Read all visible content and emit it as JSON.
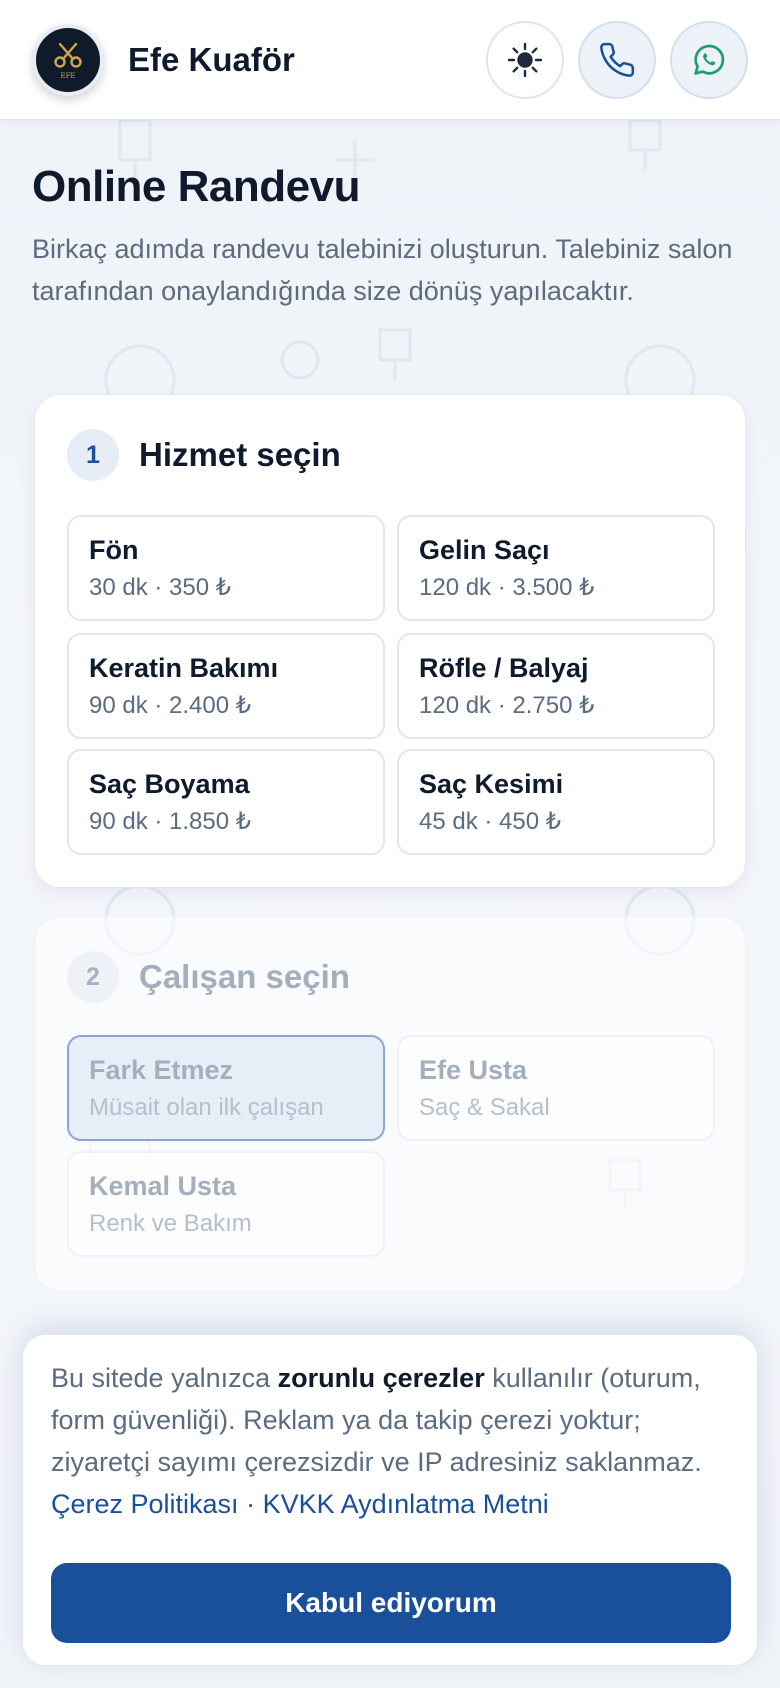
{
  "header": {
    "brand": "Efe Kuaför",
    "logo_text": "EFE",
    "icons": {
      "theme": "sun-icon",
      "phone": "phone-icon",
      "whatsapp": "whatsapp-icon"
    }
  },
  "page": {
    "title": "Online Randevu",
    "description": "Birkaç adımda randevu talebinizi oluşturun. Talebiniz salon tarafından onaylandığında size dönüş yapılacaktır."
  },
  "step1": {
    "number": "1",
    "title": "Hizmet seçin",
    "services": [
      {
        "name": "Fön",
        "meta": "30 dk · 350 ₺"
      },
      {
        "name": "Gelin Saçı",
        "meta": "120 dk · 3.500 ₺"
      },
      {
        "name": "Keratin Bakımı",
        "meta": "90 dk · 2.400 ₺"
      },
      {
        "name": "Röfle / Balyaj",
        "meta": "120 dk · 2.750 ₺"
      },
      {
        "name": "Saç Boyama",
        "meta": "90 dk · 1.850 ₺"
      },
      {
        "name": "Saç Kesimi",
        "meta": "45 dk · 450 ₺"
      }
    ]
  },
  "step2": {
    "number": "2",
    "title": "Çalışan seçin",
    "staff": [
      {
        "name": "Fark Etmez",
        "meta": "Müsait olan ilk çalışan"
      },
      {
        "name": "Efe Usta",
        "meta": "Saç & Sakal"
      },
      {
        "name": "Kemal Usta",
        "meta": "Renk ve Bakım"
      }
    ]
  },
  "cookie": {
    "text_before": "Bu sitede yalnızca ",
    "text_bold": "zorunlu çerezler",
    "text_after": " kullanılır (oturum, form güvenliği). Reklam ya da takip çerezi yoktur; ziyaretçi sayımı çerezsizdir ve IP adresiniz saklanmaz.",
    "policy_link": "Çerez Politikası",
    "separator": " · ",
    "kvkk_link": "KVKK Aydınlatma Metni",
    "accept_label": "Kabul ediyorum"
  },
  "colors": {
    "accent": "#1a4f9c",
    "whatsapp": "#1f9d6b",
    "text_dark": "#0f1b2d",
    "text_muted": "#5b6b80"
  }
}
